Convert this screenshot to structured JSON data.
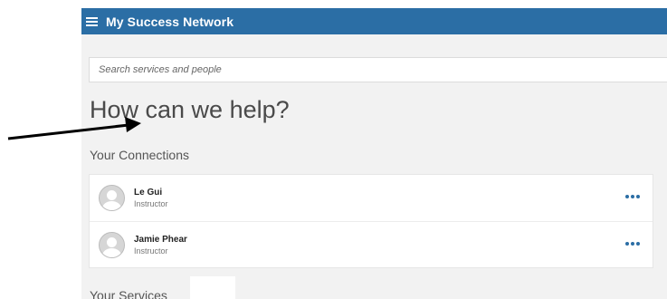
{
  "header": {
    "title": "My Success Network",
    "menu_icon": "hamburger-menu-icon",
    "color": "#2b6ea5"
  },
  "search": {
    "placeholder": "Search services and people"
  },
  "main": {
    "heading": "How can we help?",
    "connections_title": "Your Connections",
    "services_title": "Your Services"
  },
  "connections": [
    {
      "name": "Le Gui",
      "role": "Instructor",
      "avatar_icon": "user-avatar-icon",
      "actions_icon": "more-options-icon"
    },
    {
      "name": "Jamie Phear",
      "role": "Instructor",
      "avatar_icon": "user-avatar-icon",
      "actions_icon": "more-options-icon"
    }
  ]
}
